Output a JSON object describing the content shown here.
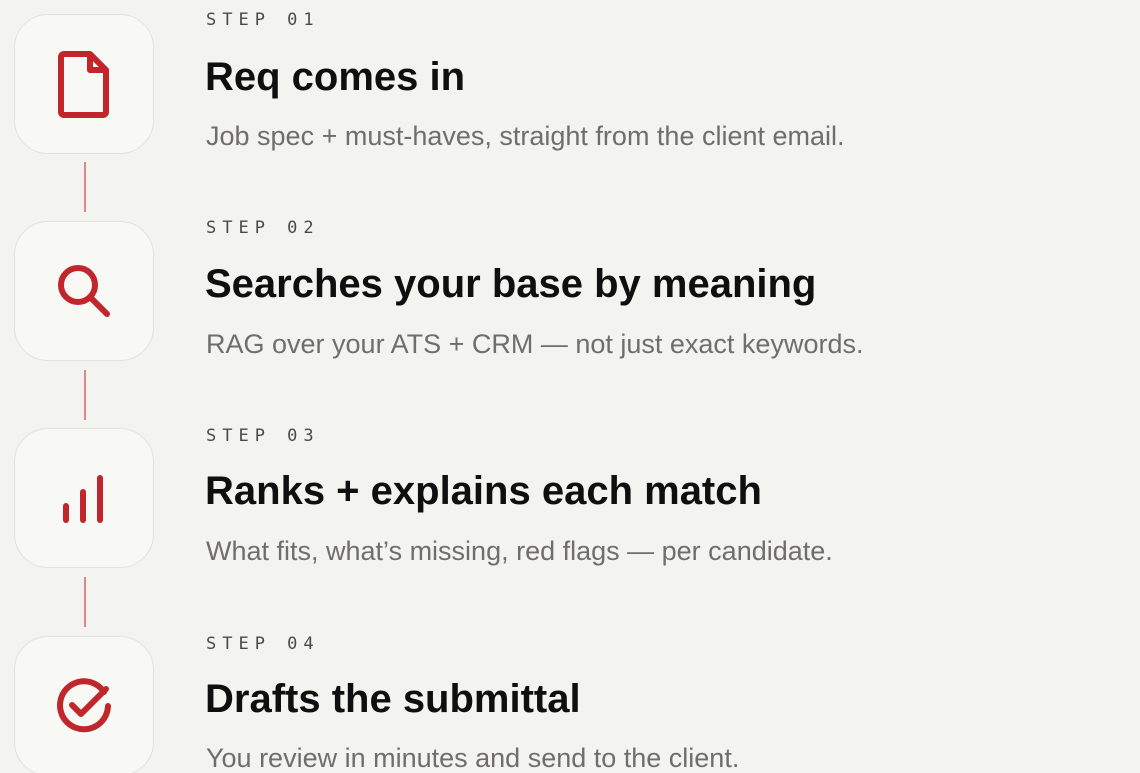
{
  "accent_color": "#c0262b",
  "steps": [
    {
      "label": "STEP 01",
      "title": "Req comes in",
      "description": "Job spec + must-haves, straight from the client email.",
      "icon": "document-icon"
    },
    {
      "label": "STEP 02",
      "title": "Searches your base by meaning",
      "description": "RAG over your ATS + CRM — not just exact keywords.",
      "icon": "search-icon"
    },
    {
      "label": "STEP 03",
      "title": "Ranks + explains each match",
      "description": "What fits, what’s missing, red flags — per candidate.",
      "icon": "bar-chart-icon"
    },
    {
      "label": "STEP 04",
      "title": "Drafts the submittal",
      "description": "You review in minutes and send to the client.",
      "icon": "check-circle-icon"
    }
  ]
}
